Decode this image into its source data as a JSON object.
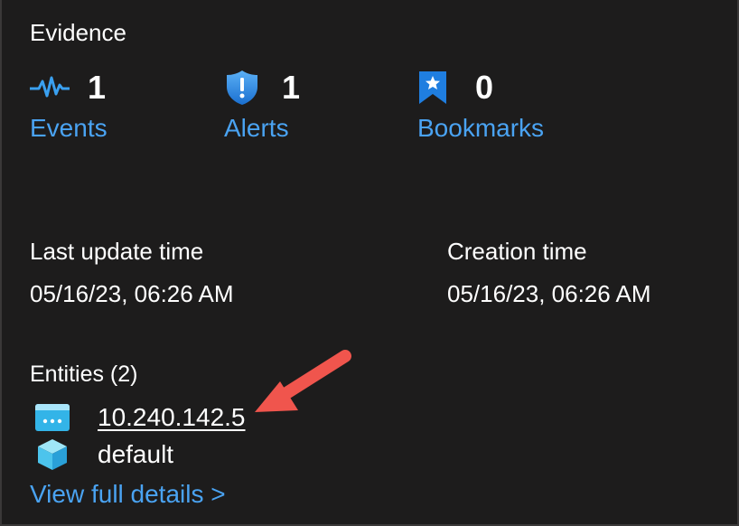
{
  "evidence": {
    "title": "Evidence",
    "items": [
      {
        "icon": "events-pulse-icon",
        "count": "1",
        "label": "Events"
      },
      {
        "icon": "alert-shield-icon",
        "count": "1",
        "label": "Alerts"
      },
      {
        "icon": "bookmark-star-icon",
        "count": "0",
        "label": "Bookmarks"
      }
    ]
  },
  "times": {
    "last_update_label": "Last update time",
    "last_update_value": "05/16/23, 06:26 AM",
    "creation_label": "Creation time",
    "creation_value": "05/16/23, 06:26 AM"
  },
  "entities": {
    "title": "Entities (2)",
    "items": [
      {
        "icon": "ip-address-icon",
        "label": "10.240.142.5",
        "link": true
      },
      {
        "icon": "cube-icon",
        "label": "default",
        "link": false
      }
    ]
  },
  "view_details_label": "View full details >",
  "colors": {
    "background": "#1d1c1c",
    "link": "#4aa3f2",
    "text": "#ffffff",
    "annotation_arrow": "#f0554d"
  }
}
